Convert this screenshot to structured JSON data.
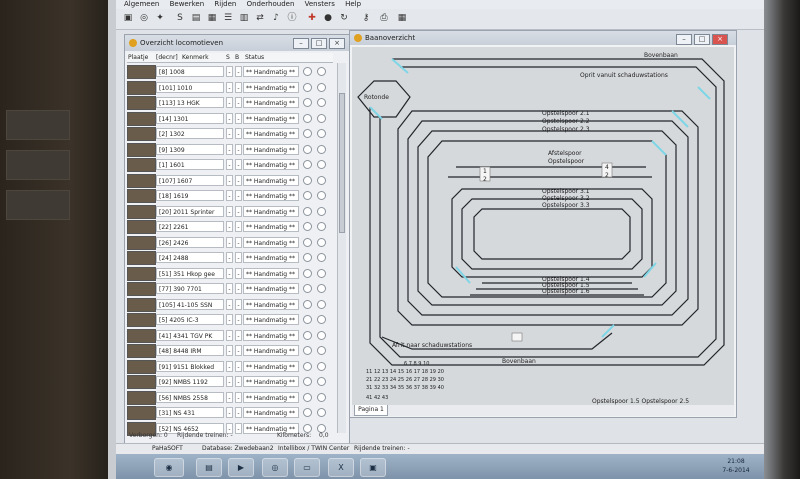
{
  "menu": [
    "Algemeen",
    "Bewerken",
    "Rijden",
    "Onderhouden",
    "Vensters",
    "Help"
  ],
  "toolbar_icons": [
    "locomotive-icon",
    "turntable-icon",
    "route-icon",
    "switch-icon",
    "signal-icon",
    "save-icon",
    "list-icon",
    "grid-icon",
    "transfer-icon",
    "bell-icon",
    "info-icon",
    "train-icon",
    "stop-icon",
    "refresh-icon",
    "keys-icon",
    "print-icon",
    "table-icon"
  ],
  "loco_panel": {
    "title": "Overzicht locomotieven",
    "columns": {
      "photo": "Plaatje",
      "address": "[decnr]",
      "mark": "Kenmerk",
      "s": "S",
      "b": "B",
      "status": "Status"
    },
    "rows": [
      {
        "name": "[8] 1008",
        "status": "** Handmatig **"
      },
      {
        "name": "[101] 1010",
        "status": "** Handmatig **"
      },
      {
        "name": "[113] 13 HGK",
        "status": "** Handmatig **"
      },
      {
        "name": "[14] 1301",
        "status": "** Handmatig **"
      },
      {
        "name": "[2] 1302",
        "status": "** Handmatig **"
      },
      {
        "name": "[9] 1309",
        "status": "** Handmatig **"
      },
      {
        "name": "[1] 1601",
        "status": "** Handmatig **"
      },
      {
        "name": "[107] 1607",
        "status": "** Handmatig **"
      },
      {
        "name": "[18] 1619",
        "status": "** Handmatig **"
      },
      {
        "name": "[20] 2011 Sprinter",
        "status": "** Handmatig **"
      },
      {
        "name": "[22] 2261",
        "status": "** Handmatig **"
      },
      {
        "name": "[26] 2426",
        "status": "** Handmatig **"
      },
      {
        "name": "[24] 2488",
        "status": "** Handmatig **"
      },
      {
        "name": "[51] 351 Hkop gee",
        "status": "** Handmatig **"
      },
      {
        "name": "[77] 390 7701",
        "status": "** Handmatig **"
      },
      {
        "name": "[105] 41-105 SSN",
        "status": "** Handmatig **"
      },
      {
        "name": "[5] 4205 IC-3",
        "status": "** Handmatig **"
      },
      {
        "name": "[41] 4341 TGV PK",
        "status": "** Handmatig **"
      },
      {
        "name": "[48] 8448 IRM",
        "status": "** Handmatig **"
      },
      {
        "name": "[91] 9151 Blokked",
        "status": "** Handmatig **"
      },
      {
        "name": "[92] NMBS 1192",
        "status": "** Handmatig **"
      },
      {
        "name": "[56] NMBS 2558",
        "status": "** Handmatig **"
      },
      {
        "name": "[31] NS 431",
        "status": "** Handmatig **"
      },
      {
        "name": "[52] NS 4652",
        "status": "** Handmatig **"
      }
    ],
    "s_value": "-",
    "b_value": "-",
    "footer": {
      "verborgen": "Verborgen: 0",
      "rijdende": "Rijdende treinen: -",
      "kilometers": "Kilometers:",
      "km_value": "0,0"
    }
  },
  "track_panel": {
    "title": "Baanoverzicht",
    "labels": {
      "bovenbaan_top": "Bovenbaan",
      "rotonde": "Rotonde",
      "oprit": "Oprit vanuit schaduwstations",
      "opstelspoor_a1": "Opstelspoor 2.1",
      "opstelspoor_a2": "Opstelspoor 2.2",
      "opstelspoor_a3": "Opstelspoor 2.3",
      "afstelspoor": "Afstelspoor",
      "opstelspoor_mid": "Opstelspoor",
      "mid_num_1": "1",
      "mid_num_2": "2",
      "mid_num_3": "3",
      "mid_num_4": "4",
      "opstelspoor_b1": "Opstelspoor 3.1",
      "opstelspoor_b2": "Opstelspoor 3.2",
      "opstelspoor_b3": "Opstelspoor 3.3",
      "opstelspoor_c1": "Opstelspoor 1.4",
      "opstelspoor_c2": "Opstelspoor 1.5",
      "opstelspoor_c3": "Opstelspoor 1.6",
      "afrit": "Afrit naar schaduwstations",
      "bovenbaan_bottom": "Bovenbaan",
      "bottom_right": "Opstelspoor 1.5    Opstelspoor 2.5",
      "grid_row1": "6   7   8   9   10",
      "grid_row2": "11   12   13   14   15   16   17   18   19   20",
      "grid_row3": "21   22   23   24   25   26   27   28   29   30",
      "grid_row4": "31   32   33   34   35   36   37   38   39   40",
      "grid_row5": "41   42   43"
    },
    "tab": "Pagina 1"
  },
  "statusbar": {
    "brand": "PaHaSOFT",
    "database": "Database: Zwedebaan2",
    "interface": "Intellibox / TWIN Center",
    "trains": "Rijdende treinen: -"
  },
  "taskbar": {
    "time": "21:08",
    "date": "7-6-2014"
  },
  "colors": {
    "track": "#22262b",
    "switch_highlight": "#7ed6e6",
    "accent_icon": "#e0a020"
  }
}
